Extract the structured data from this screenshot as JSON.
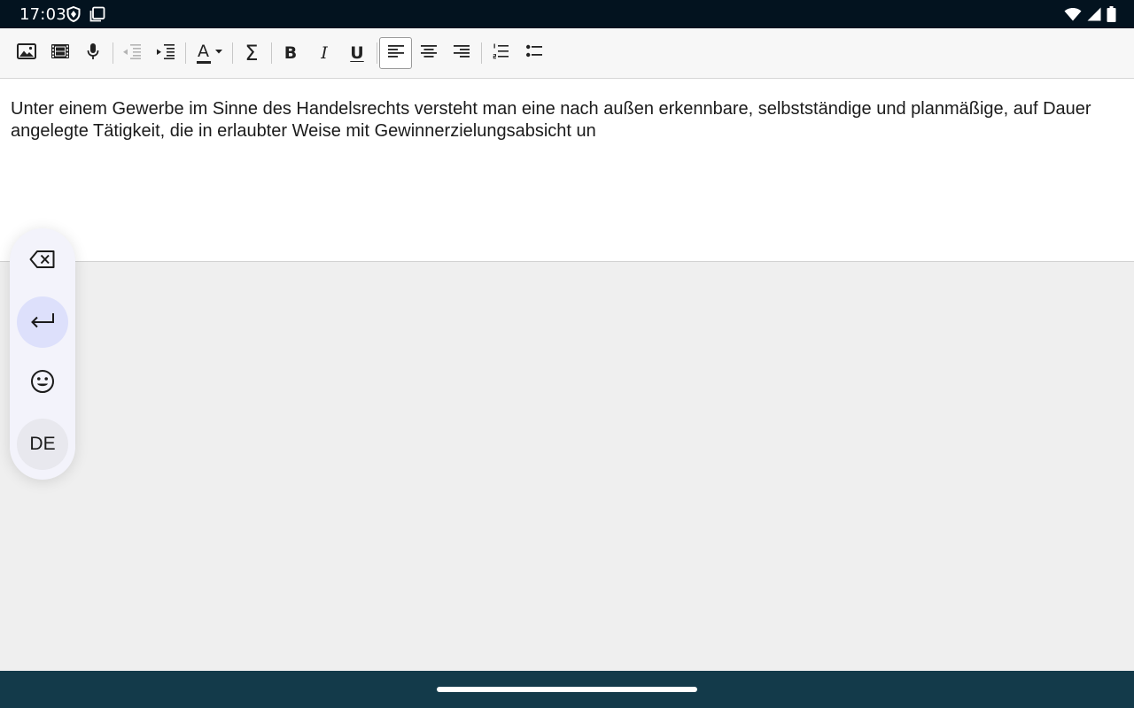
{
  "status_bar": {
    "time": "17:03",
    "left_icons": [
      "shield-icon",
      "screen-icon"
    ],
    "right_icons": [
      "wifi-icon",
      "cell-signal-icon",
      "battery-icon"
    ]
  },
  "toolbar": {
    "buttons": [
      {
        "name": "insert-image",
        "icon": "image-icon"
      },
      {
        "name": "insert-video",
        "icon": "film-icon"
      },
      {
        "name": "record-audio",
        "icon": "microphone-icon"
      },
      {
        "name": "decrease-indent",
        "icon": "outdent-icon"
      },
      {
        "name": "increase-indent",
        "icon": "indent-icon"
      },
      {
        "name": "text-color",
        "icon": "text-color-icon",
        "label": "A"
      },
      {
        "name": "formula",
        "icon": "sigma-icon",
        "label": "Σ"
      },
      {
        "name": "bold",
        "icon": "bold-icon",
        "label": "B"
      },
      {
        "name": "italic",
        "icon": "italic-icon",
        "label": "I"
      },
      {
        "name": "underline",
        "icon": "underline-icon",
        "label": "U"
      },
      {
        "name": "align-left",
        "icon": "align-left-icon",
        "active": true
      },
      {
        "name": "align-center",
        "icon": "align-center-icon"
      },
      {
        "name": "align-right",
        "icon": "align-right-icon"
      },
      {
        "name": "numbered-list",
        "icon": "numbered-list-icon"
      },
      {
        "name": "bullet-list",
        "icon": "bullet-list-icon"
      }
    ]
  },
  "editor": {
    "content": "Unter einem Gewerbe im Sinne des Handelsrechts versteht man eine nach außen erkennbare, selbstständige und planmäßige, auf Dauer angelegte Tätigkeit, die in erlaubter Weise mit Gewinnerzielungsabsicht un"
  },
  "floating_keyboard": {
    "buttons": [
      {
        "name": "backspace",
        "icon": "backspace-icon"
      },
      {
        "name": "enter",
        "icon": "enter-arrow-icon"
      },
      {
        "name": "emoji",
        "icon": "emoji-icon"
      }
    ],
    "language_label": "DE"
  },
  "colors": {
    "status_bar_bg": "#03131f",
    "nav_bar_bg": "#133a4a",
    "toolbar_bg": "#f7f7f7",
    "editor_bg": "#ffffff",
    "page_bg": "#efefef",
    "keyboard_bg": "#f3f3fb",
    "enter_highlight": "#dde0fb"
  }
}
